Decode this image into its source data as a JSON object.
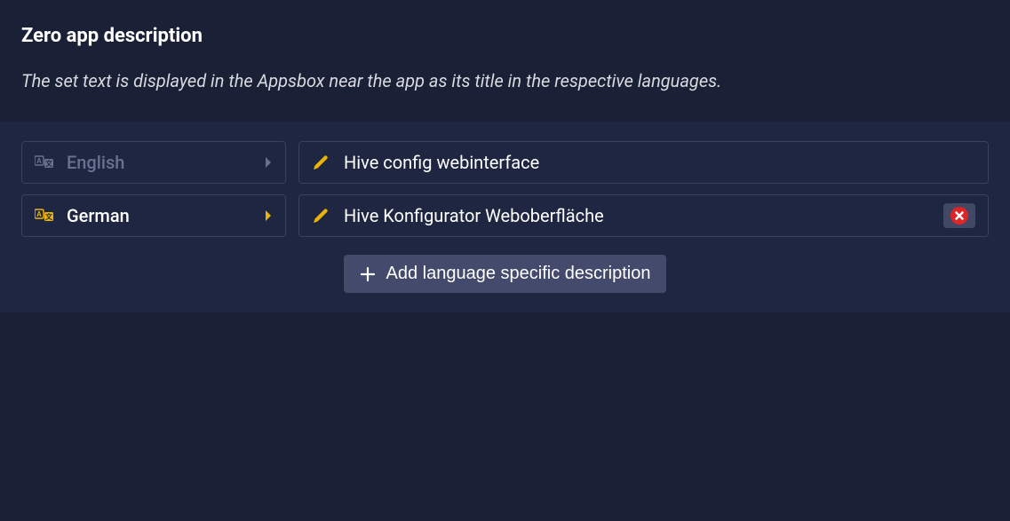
{
  "header": {
    "title": "Zero app description",
    "subtitle": "The set text is displayed in the Appsbox near the app as its title in the respective languages."
  },
  "rows": [
    {
      "language": "English",
      "value": "Hive config webinterface",
      "dimmed": true,
      "removable": false
    },
    {
      "language": "German",
      "value": "Hive Konfigurator Weboberfläche",
      "dimmed": false,
      "removable": true
    }
  ],
  "addButton": {
    "label": "Add language specific description"
  }
}
